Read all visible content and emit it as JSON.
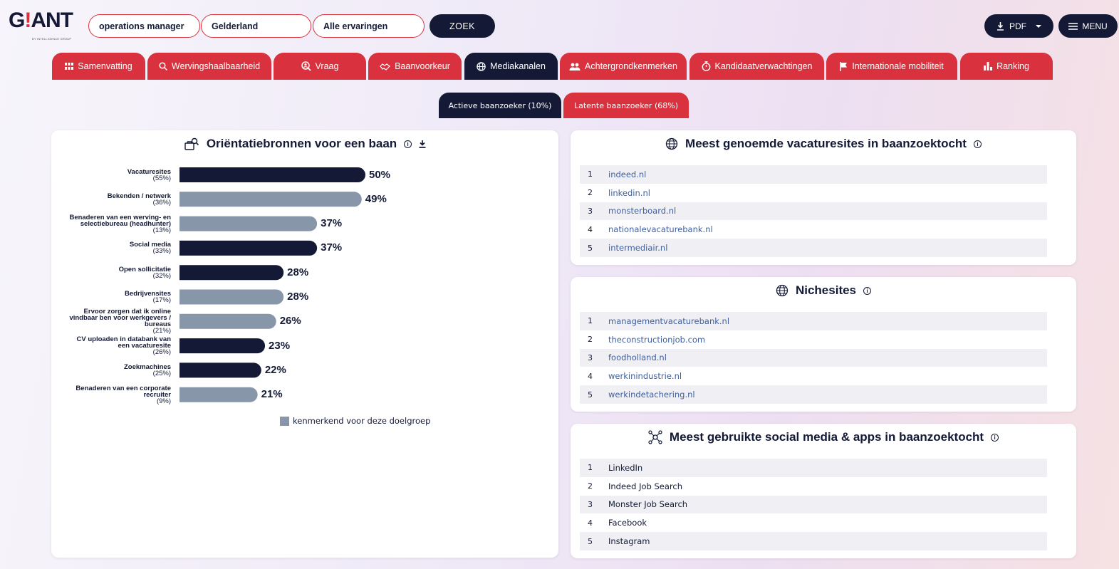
{
  "brand": {
    "logo_text_1": "G",
    "logo_text_accent": "!",
    "logo_text_2": "ANT",
    "logo_subtext": "BY INTELLIGENCE GROUP"
  },
  "search": {
    "job_value": "operations manager",
    "region_value": "Gelderland",
    "experience_value": "Alle ervaringen",
    "submit_label": "ZOEK"
  },
  "toolbar": {
    "pdf_label": "PDF",
    "menu_label": "MENU"
  },
  "tabs": [
    {
      "label": "Samenvatting",
      "icon": "grid-icon"
    },
    {
      "label": "Wervingshaalbaarheid",
      "icon": "search-icon"
    },
    {
      "label": "Vraag",
      "icon": "magnify-person-icon"
    },
    {
      "label": "Baanvoorkeur",
      "icon": "handshake-icon"
    },
    {
      "label": "Mediakanalen",
      "icon": "globe-icon"
    },
    {
      "label": "Achtergrondkenmerken",
      "icon": "people-icon"
    },
    {
      "label": "Kandidaatverwachtingen",
      "icon": "stopwatch-icon"
    },
    {
      "label": "Internationale mobiliteit",
      "icon": "flag-icon"
    },
    {
      "label": "Ranking",
      "icon": "bar-chart-icon"
    }
  ],
  "active_tab": "Mediakanalen",
  "subtabs": [
    {
      "label": "Actieve baanzoeker (10%)"
    },
    {
      "label": "Latente baanzoeker (68%)"
    }
  ],
  "orientation": {
    "title": "Oriëntatiebronnen voor een baan",
    "legend": "kenmerkend voor deze doelgroep"
  },
  "chart_data": {
    "type": "bar",
    "orientation": "horizontal",
    "title": "Oriëntatiebronnen voor een baan",
    "categories": [
      "Vacaturesites",
      "Bekenden / netwerk",
      "Benaderen van een werving- en selectiebureau (headhunter)",
      "Social media",
      "Open sollicitatie",
      "Bedrijvensites",
      "Ervoor zorgen dat ik online vindbaar ben voor werkgevers / bureaus",
      "CV uploaden in databank van een vacaturesite",
      "Zoekmachines",
      "Benaderen van een corporate recruiter"
    ],
    "category_lines": [
      [
        "Vacaturesites"
      ],
      [
        "Bekenden / netwerk"
      ],
      [
        "Benaderen van een werving- en",
        "selectiebureau (headhunter)"
      ],
      [
        "Social media"
      ],
      [
        "Open sollicitatie"
      ],
      [
        "Bedrijvensites"
      ],
      [
        "Ervoor zorgen dat ik online",
        "vindbaar ben voor werkgevers /",
        "bureaus"
      ],
      [
        "CV uploaden in databank van",
        "een vacaturesite"
      ],
      [
        "Zoekmachines"
      ],
      [
        "Benaderen van een corporate",
        "recruiter"
      ]
    ],
    "reference_values": [
      "(55%)",
      "(36%)",
      "(13%)",
      "(33%)",
      "(32%)",
      "(17%)",
      "(21%)",
      "(26%)",
      "(25%)",
      "(9%)"
    ],
    "values": [
      50,
      49,
      37,
      37,
      28,
      28,
      26,
      23,
      22,
      21
    ],
    "value_labels": [
      "50%",
      "49%",
      "37%",
      "37%",
      "28%",
      "28%",
      "26%",
      "23%",
      "22%",
      "21%"
    ],
    "characteristic": [
      false,
      true,
      true,
      false,
      false,
      true,
      true,
      false,
      false,
      true
    ],
    "colors": {
      "default": "#141a36",
      "characteristic": "#8796a8"
    },
    "xlim": [
      0,
      100
    ],
    "legend": "kenmerkend voor deze doelgroep",
    "grid": false
  },
  "vacature_sites": {
    "title": "Meest genoemde vacaturesites in baanzoektocht",
    "items": [
      {
        "rank": "1",
        "name": "indeed.nl"
      },
      {
        "rank": "2",
        "name": "linkedin.nl"
      },
      {
        "rank": "3",
        "name": "monsterboard.nl"
      },
      {
        "rank": "4",
        "name": "nationalevacaturebank.nl"
      },
      {
        "rank": "5",
        "name": "intermediair.nl"
      }
    ]
  },
  "niche_sites": {
    "title": "Nichesites",
    "items": [
      {
        "rank": "1",
        "name": "managementvacaturebank.nl"
      },
      {
        "rank": "2",
        "name": "theconstructionjob.com"
      },
      {
        "rank": "3",
        "name": "foodholland.nl"
      },
      {
        "rank": "4",
        "name": "werkinindustrie.nl"
      },
      {
        "rank": "5",
        "name": "werkindetachering.nl"
      }
    ]
  },
  "social_media": {
    "title": "Meest gebruikte social media & apps in baanzoektocht",
    "items": [
      {
        "rank": "1",
        "name": "LinkedIn"
      },
      {
        "rank": "2",
        "name": "Indeed Job Search"
      },
      {
        "rank": "3",
        "name": "Monster Job Search"
      },
      {
        "rank": "4",
        "name": "Facebook"
      },
      {
        "rank": "5",
        "name": "Instagram"
      }
    ]
  },
  "colors": {
    "primary": "#141a36",
    "accent": "#d9323e",
    "bar_muted": "#8796a8",
    "link": "#3d5fa0"
  }
}
